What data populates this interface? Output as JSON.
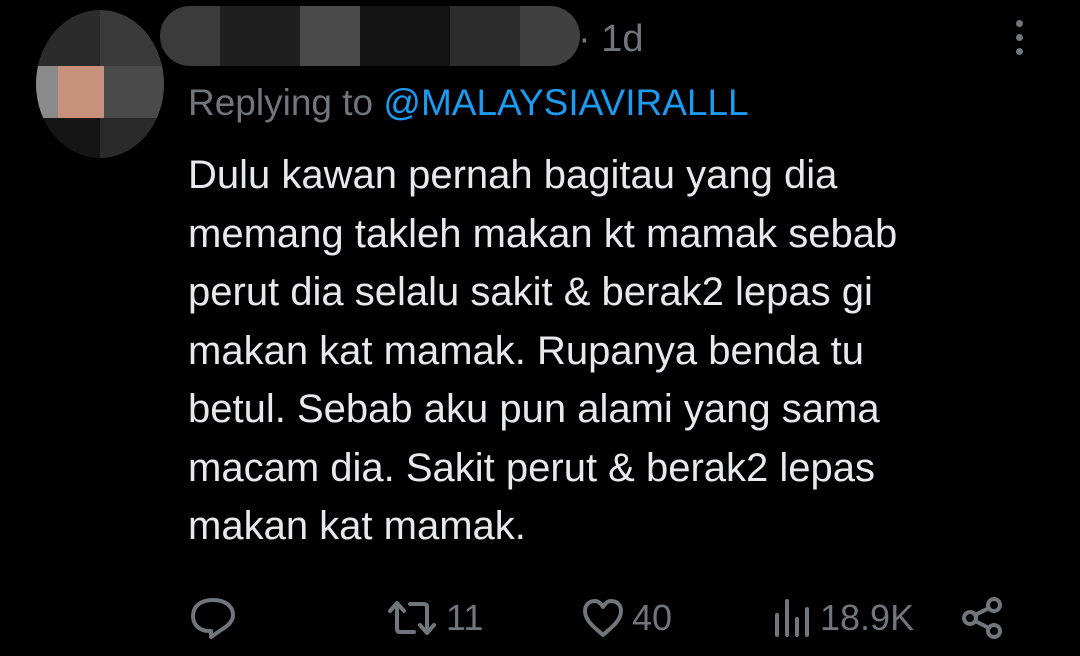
{
  "tweet": {
    "timestamp": "· 1d",
    "reply_prefix": "Replying to ",
    "reply_handle": "@MALAYSIAVIRALLL",
    "lines": [
      "Dulu kawan pernah bagitau yang dia",
      "memang takleh makan kt mamak sebab",
      "perut dia selalu sakit & berak2 lepas gi",
      "makan kat mamak. Rupanya benda tu",
      "betul. Sebab aku pun alami yang sama",
      "macam dia. Sakit perut & berak2 lepas",
      "makan kat mamak."
    ]
  },
  "actions": {
    "reply_icon": "reply-bubble-icon",
    "retweet_count": "11",
    "like_count": "40",
    "views_count": "18.9K",
    "share_icon": "share-icon"
  },
  "colors": {
    "background": "#000000",
    "text": "#e7e9ea",
    "muted": "#71767b",
    "link": "#1d9bf0"
  }
}
